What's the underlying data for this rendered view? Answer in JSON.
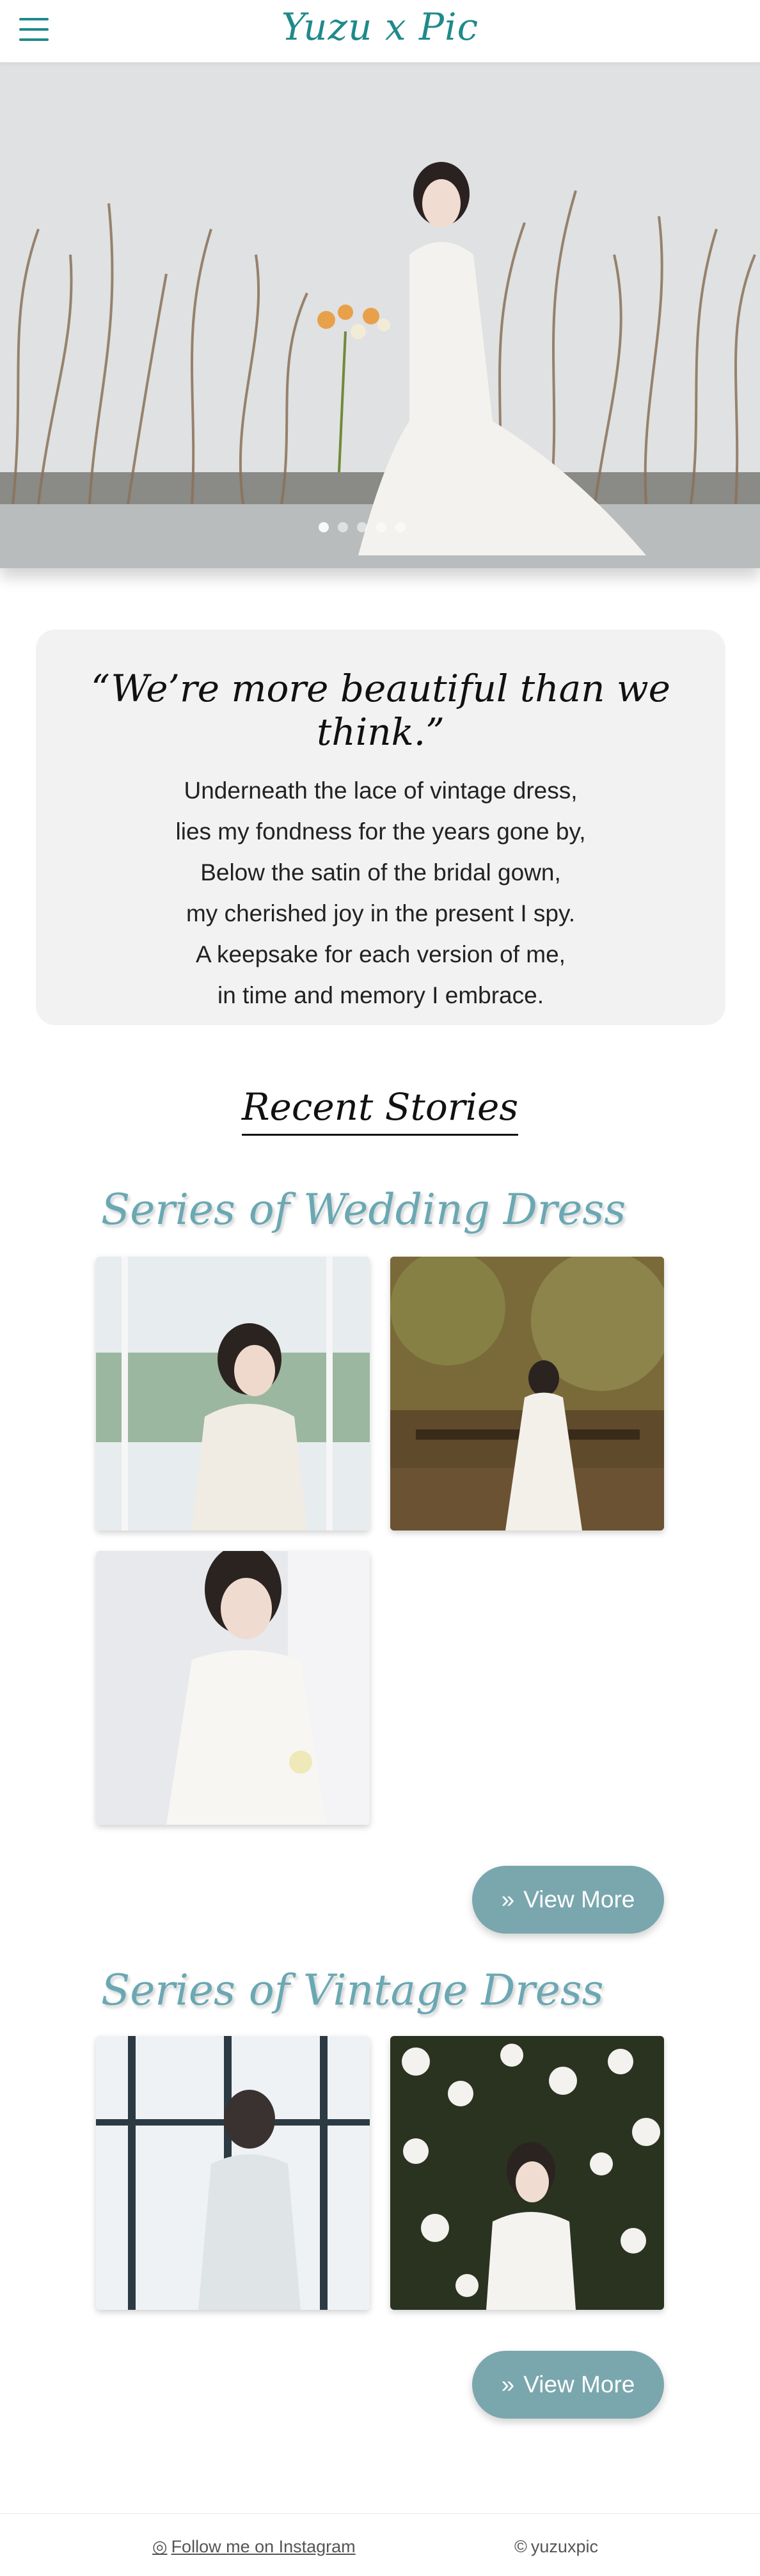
{
  "header": {
    "logo": "Yuzu x Pic",
    "menu_icon": "hamburger-menu-icon"
  },
  "hero": {
    "slide_count": 5,
    "active_slide": 1
  },
  "quote": {
    "title": "“We’re more beautiful than we think.”",
    "lines": [
      "Underneath the lace of vintage dress,",
      "lies my fondness for the years gone by,",
      "Below the satin of the bridal gown,",
      "my cherished joy in the present I spy.",
      "A keepsake for each version of me,",
      "in time and memory I embrace."
    ]
  },
  "recent": {
    "title": "Recent Stories"
  },
  "series": [
    {
      "title": "Series of Wedding Dress",
      "button": "View More"
    },
    {
      "title": "Series of Vintage Dress",
      "button": "View More"
    }
  ],
  "footer": {
    "instagram": "Follow me on Instagram",
    "copyright": "yuzuxpic"
  },
  "colors": {
    "brand": "#1f8a8a",
    "series": "#6aa8b3",
    "button": "#7aa7ae"
  }
}
